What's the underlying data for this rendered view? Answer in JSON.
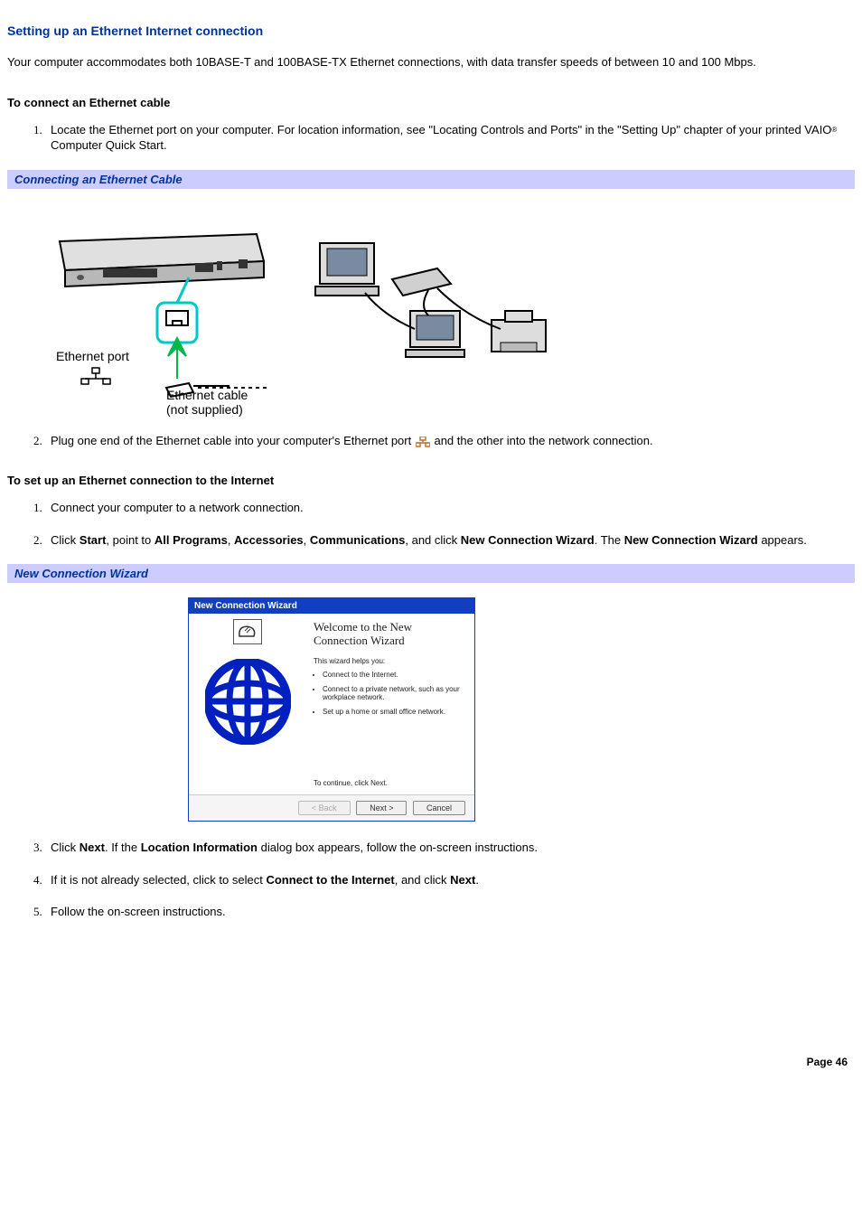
{
  "title": "Setting up an Ethernet Internet connection",
  "intro": "Your computer accommodates both 10BASE-T and 100BASE-TX Ethernet connections, with data transfer speeds of between 10 and 100 Mbps.",
  "section1": {
    "heading": "To connect an Ethernet cable",
    "step1_a": "Locate the Ethernet port on your computer. For location information, see \"Locating Controls and Ports\" in the \"Setting Up\" chapter of your printed VAIO",
    "step1_b": " Computer Quick Start.",
    "figure_title": "Connecting an Ethernet Cable",
    "labels": {
      "port": "Ethernet port",
      "cable": "Ethernet cable",
      "not_supplied": "(not supplied)"
    },
    "step2_a": "Plug one end of the Ethernet cable into your computer's Ethernet port ",
    "step2_b": "and the other into the network connection."
  },
  "section2": {
    "heading": "To set up an Ethernet connection to the Internet",
    "step1": "Connect your computer to a network connection.",
    "step2": {
      "a": "Click ",
      "b": "Start",
      "c": ", point to ",
      "d": "All Programs",
      "e": ", ",
      "f": "Accessories",
      "g": ", ",
      "h": "Communications",
      "i": ", and click ",
      "j": "New Connection Wizard",
      "k": ". The ",
      "l": "New Connection Wizard",
      "m": " appears."
    },
    "figure_title": "New Connection Wizard",
    "wizard": {
      "titlebar": "New Connection Wizard",
      "welcome": "Welcome to the New Connection Wizard",
      "helps": "This wizard helps you:",
      "bullets": [
        "Connect to the Internet.",
        "Connect to a private network, such as your workplace network.",
        "Set up a home or small office network."
      ],
      "continue": "To continue, click Next.",
      "back": "< Back",
      "next": "Next >",
      "cancel": "Cancel"
    },
    "step3": {
      "a": "Click ",
      "b": "Next",
      "c": ". If the ",
      "d": "Location Information",
      "e": " dialog box appears, follow the on-screen instructions."
    },
    "step4": {
      "a": "If it is not already selected, click to select ",
      "b": "Connect to the Internet",
      "c": ", and click ",
      "d": "Next",
      "e": "."
    },
    "step5": "Follow the on-screen instructions."
  },
  "footer": "Page 46"
}
